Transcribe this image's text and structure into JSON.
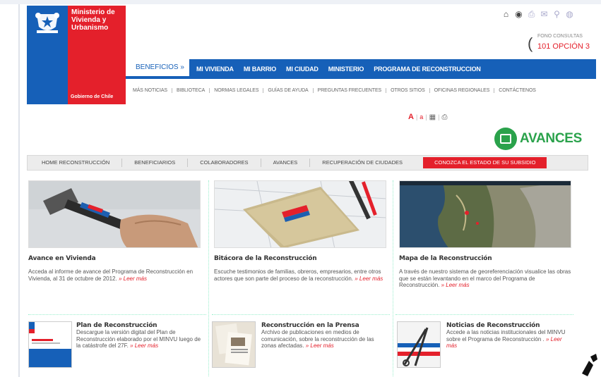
{
  "header": {
    "ministry_title": "Ministerio de Vivienda y Urbanismo",
    "gov_label": "Gobierno de Chile",
    "fono_label": "FONO CONSULTAS",
    "fono_number": "101 OPCIÓN 3"
  },
  "main_nav": {
    "beneficios": "BENEFICIOS »",
    "items": [
      "MI VIVIENDA",
      "MI BARRIO",
      "MI CIUDAD",
      "MINISTERIO",
      "PROGRAMA DE RECONSTRUCCION"
    ]
  },
  "sub_nav": [
    "MÁS NOTICIAS",
    "BIBLIOTECA",
    "NORMAS LEGALES",
    "GUÍAS DE AYUDA",
    "PREGUNTAS FRECUENTES",
    "OTROS SITIOS",
    "OFICINAS REGIONALES",
    "CONTÁCTENOS"
  ],
  "text_tools": {
    "big_a": "A",
    "small_a": "a"
  },
  "badge": {
    "label": "AVANCES"
  },
  "section_nav": {
    "items": [
      "HOME RECONSTRUCCIÓN",
      "BENEFICIARIOS",
      "COLABORADORES",
      "AVANCES",
      "RECUPERACIÓN DE CIUDADES"
    ],
    "active": "CONOZCA EL ESTADO DE SU SUBSIDIO"
  },
  "cards": [
    {
      "title": "Avance en Vivienda",
      "text": "Acceda al informe de avance del Programa de Reconstrucción en Vivienda, al 31 de octubre de 2012.",
      "more": "» Leer más"
    },
    {
      "title": "Bitácora de la Reconstrucción",
      "text": "Escuche testimonios de familias, obreros, empresarios, entre otros actores que son parte del proceso de la reconstrucción.",
      "more": "» Leer más"
    },
    {
      "title": "Mapa de la Reconstrucción",
      "text": "A través de nuestro sistema de georeferenciación visualice las obras que se están levantando en el marco del Programa de Reconstrucción.",
      "more": "» Leer más"
    }
  ],
  "lower": [
    {
      "title": "Plan de Reconstrucción",
      "text": "Descargue la versión digital del Plan de Reconstrucción elaborado por el MINVU luego de la catástrofe del 27F.",
      "more": "» Leer más"
    },
    {
      "title": "Reconstrucción en la Prensa",
      "text": "Archivo de publicaciones en medios de comunicación, sobre la reconstrucción de las zonas afectadas.",
      "more": "» Leer más"
    },
    {
      "title": "Noticias de Reconstrucción",
      "text": "Accede a las noticias institucionales del MINVU sobre el Programa de Reconstrucción .",
      "more": "» Leer más"
    }
  ]
}
